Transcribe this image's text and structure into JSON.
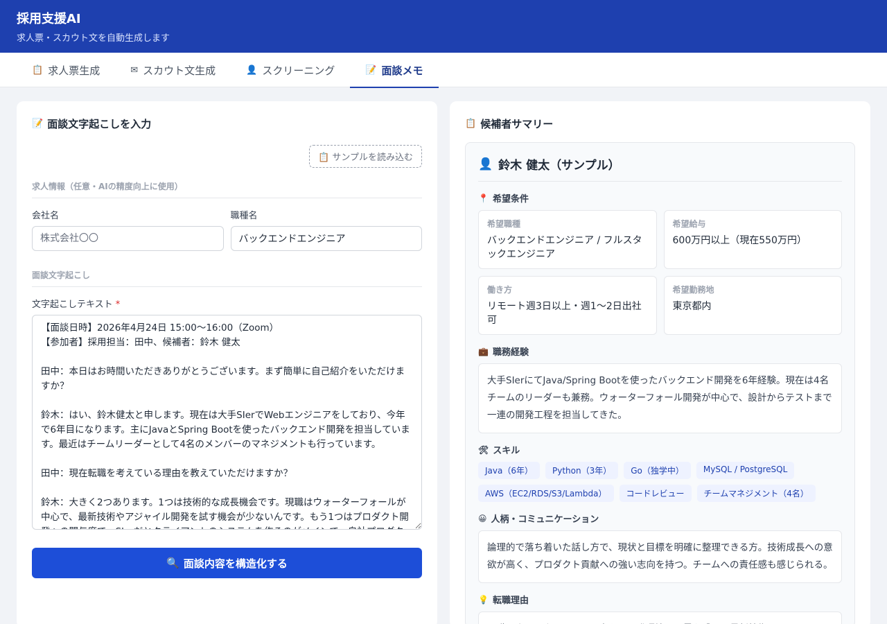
{
  "app": {
    "title": "採用支援AI",
    "subtitle": "求人票・スカウト文を自動生成します"
  },
  "tabs": [
    {
      "icon": "clipboard-icon",
      "glyph": "📋",
      "label": "求人票生成"
    },
    {
      "icon": "envelope-icon",
      "glyph": "✉",
      "label": "スカウト文生成"
    },
    {
      "icon": "user-icon",
      "glyph": "👤",
      "label": "スクリーニング"
    },
    {
      "icon": "memo-icon",
      "glyph": "📝",
      "label": "面談メモ"
    }
  ],
  "left": {
    "title": "面談文字起こしを入力",
    "title_icon": "📝",
    "sample_button": "サンプルを読み込む",
    "sample_icon": "📋",
    "job_section": "求人情報（任意・AIの精度向上に使用）",
    "company_label": "会社名",
    "company_placeholder": "株式会社〇〇",
    "company_value": "",
    "position_label": "職種名",
    "position_value": "バックエンドエンジニア",
    "transcript_section": "面談文字起こし",
    "transcript_label": "文字起こしテキスト",
    "required_mark": "*",
    "transcript_value": "【面談日時】2026年4月24日 15:00〜16:00（Zoom）\n【参加者】採用担当：田中、候補者：鈴木 健太\n\n田中：本日はお時間いただきありがとうございます。まず簡単に自己紹介をいただけますか？\n\n鈴木：はい、鈴木健太と申します。現在は大手SIerでWebエンジニアをしており、今年で6年目になります。主にJavaとSpring Bootを使ったバックエンド開発を担当しています。最近はチームリーダーとして4名のメンバーのマネジメントも行っています。\n\n田中：現在転職を考えている理由を教えていただけますか？\n\n鈴木：大きく2つあります。1つは技術的な成長機会です。現職はウォーターフォールが中心で、最新技術やアジャイル開発を試す機会が少ないんです。もう1つはプロダクト開発への関与度で、SIerだとクライアントのシステムを作るのがメインで、自社プロダクトに関わりたいと考えています。",
    "submit_button": "面談内容を構造化する",
    "submit_icon": "🔍"
  },
  "right": {
    "title": "候補者サマリー",
    "title_icon": "📋",
    "candidate_name": "鈴木 健太（サンプル）",
    "candidate_icon": "👤",
    "conditions_head": "希望条件",
    "conditions_icon": "📍",
    "conditions": [
      {
        "key": "希望職種",
        "value": "バックエンドエンジニア / フルスタックエンジニア"
      },
      {
        "key": "希望給与",
        "value": "600万円以上（現在550万円）"
      },
      {
        "key": "働き方",
        "value": "リモート週3日以上・週1〜2日出社可"
      },
      {
        "key": "希望勤務地",
        "value": "東京都内"
      }
    ],
    "experience_head": "職務経験",
    "experience_icon": "💼",
    "experience_text": "大手SIerにてJava/Spring Bootを使ったバックエンド開発を6年経験。現在は4名チームのリーダーも兼務。ウォーターフォール開発が中心で、設計からテストまで一連の開発工程を担当してきた。",
    "skills_head": "スキル",
    "skills_icon": "🛠",
    "skills": [
      "Java（6年）",
      "Python（3年）",
      "Go（独学中）",
      "MySQL / PostgreSQL",
      "AWS（EC2/RDS/S3/Lambda）",
      "コードレビュー",
      "チームマネジメント（4名）"
    ],
    "personality_head": "人柄・コミュニケーション",
    "personality_icon": "😀",
    "personality_text": "論理的で落ち着いた話し方で、現状と目標を明確に整理できる方。技術成長への意欲が高く、プロダクト貢献への強い志向を持つ。チームへの責任感も感じられる。",
    "reason_head": "転職理由",
    "reason_icon": "💡",
    "reason_text": "現職のウォーターフォール中心の開発環境に限界を感じ、最新技術・アジャイル"
  },
  "colors": {
    "header_bg": "#1e40af",
    "primary_button": "#1d4ed8",
    "page_bg": "#f1f3f7"
  }
}
